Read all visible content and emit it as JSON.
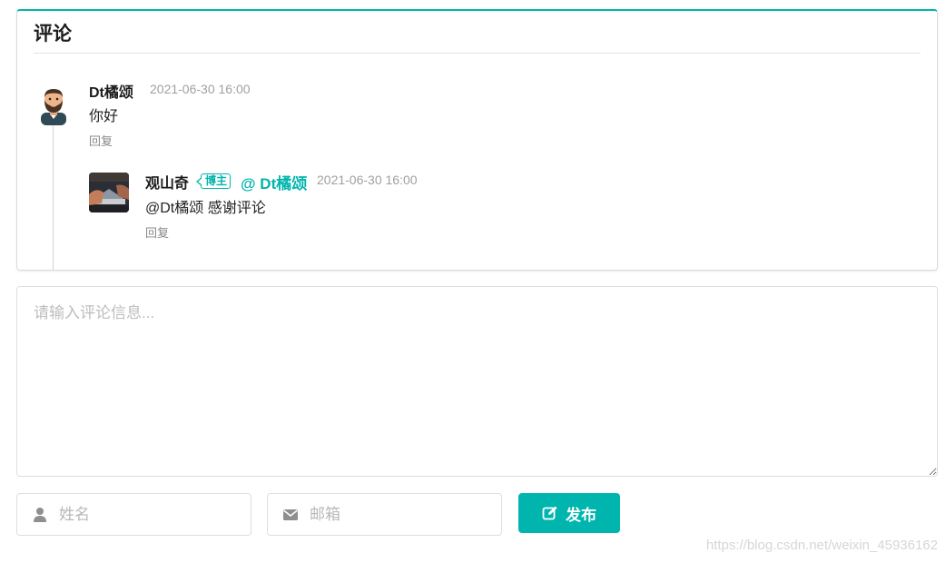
{
  "section": {
    "title": "评论"
  },
  "comments": [
    {
      "author": "Dt橘颂",
      "date": "2021-06-30 16:00",
      "text": "你好",
      "reply_label": "回复",
      "avatar_icon": "bearded-man-avatar"
    }
  ],
  "replies": [
    {
      "author": "观山奇",
      "badge": "博主",
      "mention": "@ Dt橘颂",
      "date": "2021-06-30 16:00",
      "text": "@Dt橘颂 感谢评论",
      "reply_label": "回复",
      "avatar_icon": "laptop-photo-avatar"
    }
  ],
  "form": {
    "textarea_placeholder": "请输入评论信息...",
    "name_placeholder": "姓名",
    "email_placeholder": "邮箱",
    "name_icon": "user-icon",
    "email_icon": "envelope-icon",
    "publish_label": "发布",
    "publish_icon": "edit-icon"
  },
  "watermark": "https://blog.csdn.net/weixin_45936162",
  "colors": {
    "accent": "#00b5ad",
    "muted_text": "#a0a0a0",
    "border": "#dedede"
  }
}
